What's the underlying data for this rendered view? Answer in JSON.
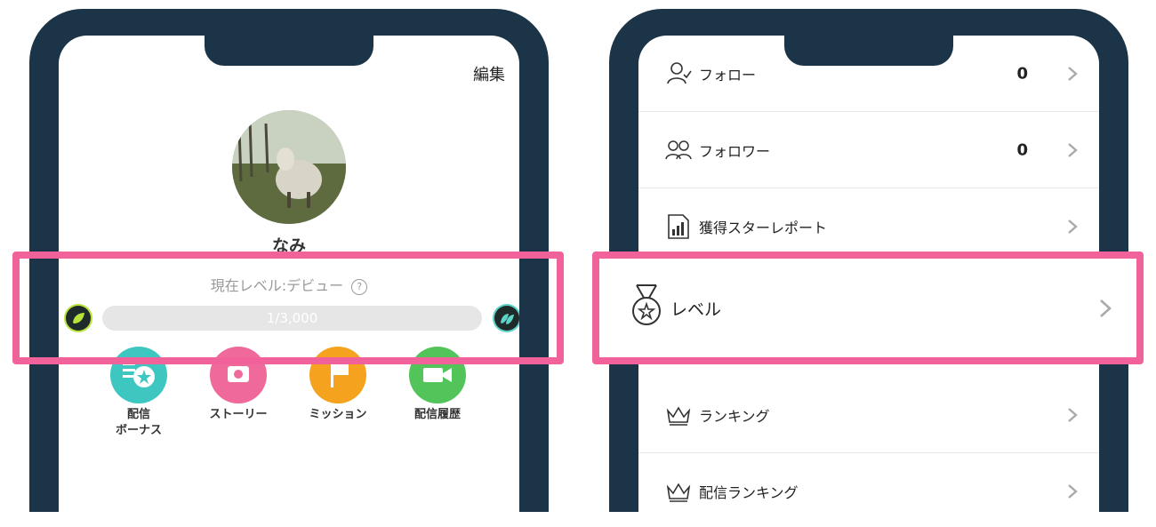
{
  "left": {
    "edit_label": "編集",
    "username": "なみ",
    "level_label": "現在レベル:デビュー",
    "help_icon": "?",
    "progress_text": "1/3,000",
    "progress_fraction": 0.0,
    "menu": [
      {
        "label": "配信\nボーナス",
        "icon": "star-coin-icon",
        "color": "#3ec7c0"
      },
      {
        "label": "ストーリー",
        "icon": "camera-icon",
        "color": "#ef6a9a"
      },
      {
        "label": "ミッション",
        "icon": "flag-icon",
        "color": "#f5a21e"
      },
      {
        "label": "配信履歴",
        "icon": "video-camera-icon",
        "color": "#52c45a"
      }
    ]
  },
  "right": {
    "rows": [
      {
        "label": "フォロー",
        "count": "0",
        "icon": "follow-user-icon"
      },
      {
        "label": "フォロワー",
        "count": "0",
        "icon": "followers-icon"
      },
      {
        "label": "獲得スターレポート",
        "icon": "report-chart-icon"
      },
      {
        "label": "レベル",
        "icon": "medal-icon"
      },
      {
        "label": "ランキング",
        "icon": "crown-icon"
      },
      {
        "label": "配信ランキング",
        "icon": "crown-icon"
      }
    ]
  },
  "colors": {
    "frame": "#1c3447",
    "highlight": "#f2629a"
  }
}
